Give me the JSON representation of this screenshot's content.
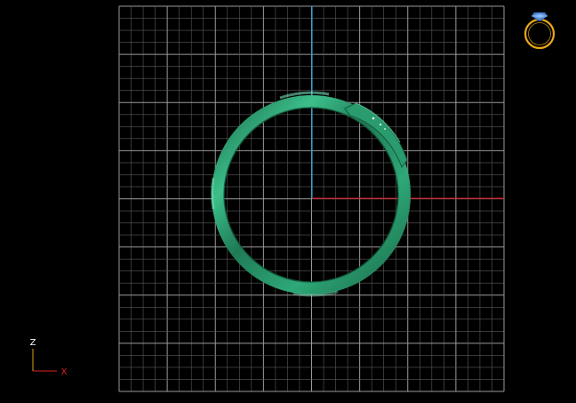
{
  "viewport": {
    "background": "#000000",
    "grid": true,
    "grid_minor_color": "#5a5a5a",
    "grid_major_color": "#9a9a9a",
    "axis_vertical_color": "#1e9bd6",
    "axis_horizontal_color": "#c8101a",
    "object_color": "#1f7a55",
    "object_highlight_color": "#3fc38e",
    "object": "ring-band"
  },
  "axis_gizmo": {
    "vertical_label": "Z",
    "horizontal_label": "X",
    "vertical_color": "#e0a020",
    "horizontal_color": "#e02020",
    "label_color": "#ffffff"
  },
  "view_cube": {
    "icon": "ring-with-gem-icon",
    "ring_color": "#e8a818",
    "gem_color": "#3a7bd5"
  }
}
